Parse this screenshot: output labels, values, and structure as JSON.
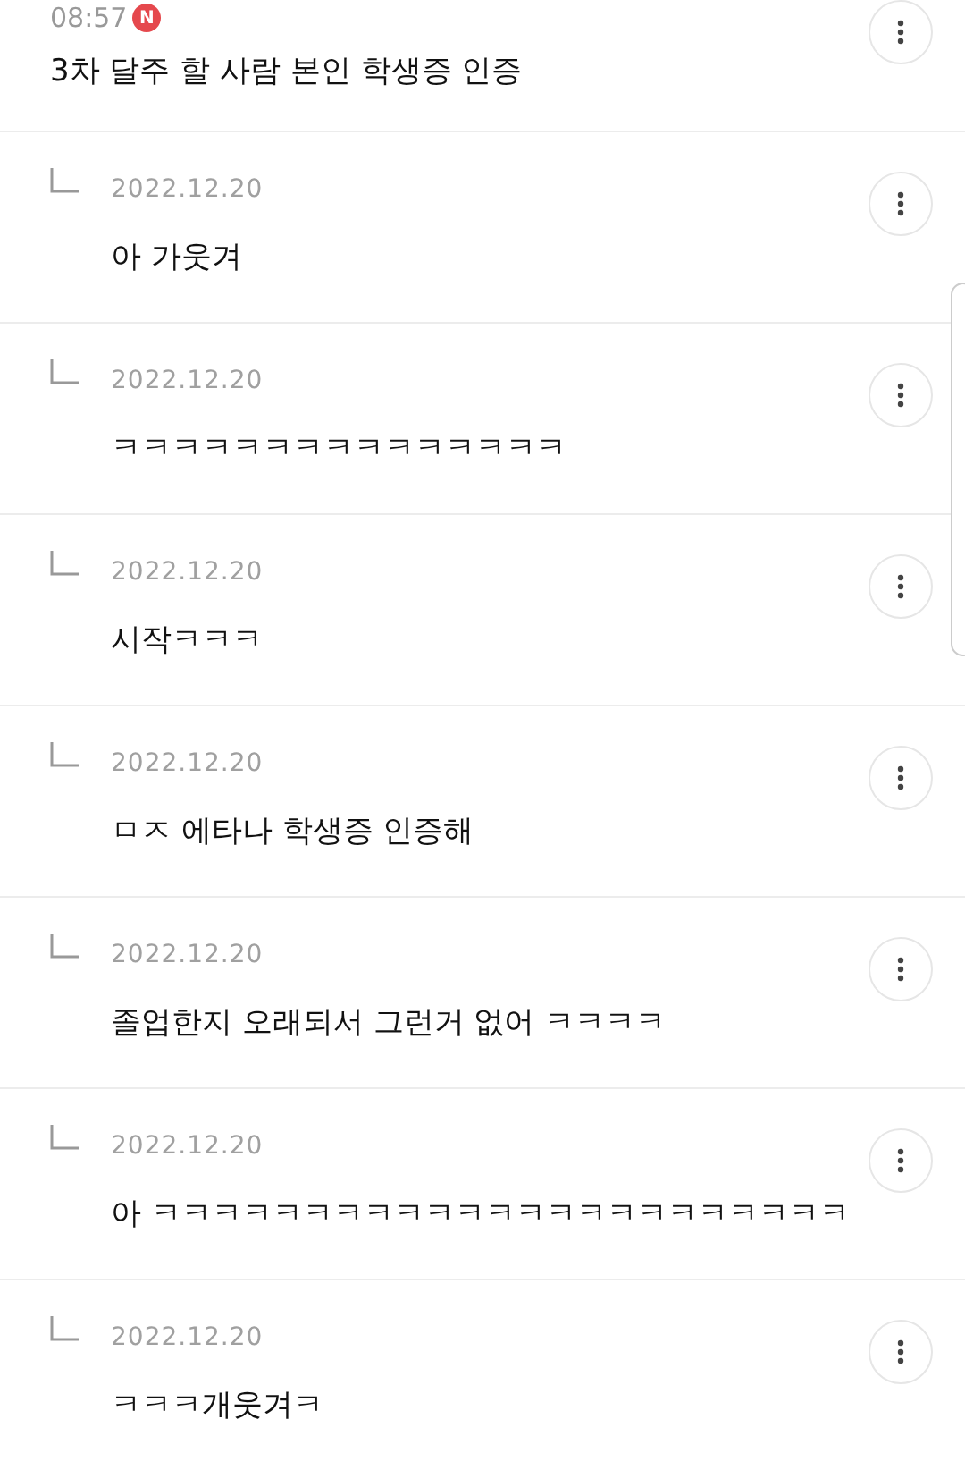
{
  "comment": {
    "time": "08:57",
    "new_badge": "N",
    "text": "3차 달주 할 사람 본인 학생증 인증"
  },
  "replies": [
    {
      "date": "2022.12.20",
      "text": "아 가웃겨"
    },
    {
      "date": "2022.12.20",
      "text": "ㅋㅋㅋㅋㅋㅋㅋㅋㅋㅋㅋㅋㅋㅋㅋ"
    },
    {
      "date": "2022.12.20",
      "text": "시작ㅋㅋㅋ"
    },
    {
      "date": "2022.12.20",
      "text": "ㅁㅈ 에타나 학생증 인증해"
    },
    {
      "date": "2022.12.20",
      "text": "졸업한지 오래되서 그런거 없어 ㅋㅋㅋㅋ"
    },
    {
      "date": "2022.12.20",
      "text": "아 ㅋㅋㅋㅋㅋㅋㅋㅋㅋㅋㅋㅋㅋㅋㅋㅋㅋㅋㅋㅋㅋㅋㅋ"
    },
    {
      "date": "2022.12.20",
      "text": "ㅋㅋㅋ개웃겨ㅋ"
    }
  ]
}
